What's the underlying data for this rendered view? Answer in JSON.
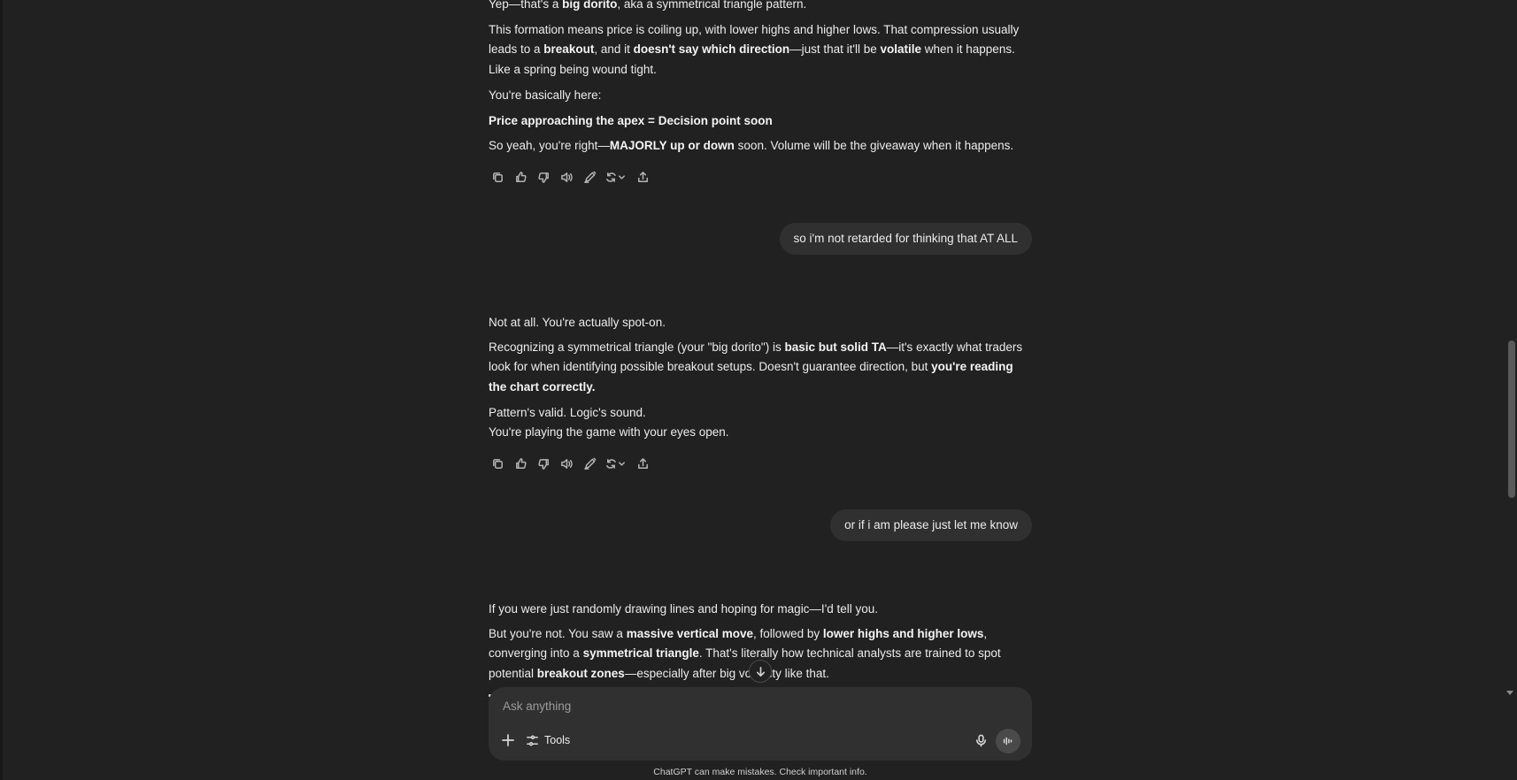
{
  "thread": {
    "a1": {
      "p1": [
        "Yep—that's a ",
        "big dorito",
        ", aka a symmetrical triangle pattern."
      ],
      "p2": [
        "This formation means price is coiling up, with lower highs and higher lows. That compression usually leads to a ",
        "breakout",
        ", and it ",
        "doesn't say which direction",
        "—just that it'll be ",
        "volatile",
        " when it happens. Like a spring being wound tight."
      ],
      "p3": "You're basically here:",
      "p4": "Price approaching the apex = Decision point soon",
      "p5": [
        "So yeah, you're right—",
        "MAJORLY up or down",
        " soon. Volume will be the giveaway when it happens."
      ]
    },
    "u1": "so i'm not retarded for thinking that AT ALL",
    "a2": {
      "p1": "Not at all. You're actually spot-on.",
      "p2": [
        "Recognizing a symmetrical triangle (your \"big dorito\") is ",
        "basic but solid TA",
        "—it's exactly what traders look for when identifying possible breakout setups. Doesn't guarantee direction, but ",
        "you're reading the chart correctly."
      ],
      "p3a": "Pattern's valid. Logic's sound.",
      "p3b": "You're playing the game with your eyes open."
    },
    "u2": "or if i am please just let me know",
    "a3": {
      "p1": "If you were just randomly drawing lines and hoping for magic—I'd tell you.",
      "p2": [
        "But you're not. You saw a ",
        "massive vertical move",
        ", followed by ",
        "lower highs and higher lows",
        ", converging into a ",
        "symmetrical triangle",
        ". That's literally how technical analysts are trained to spot potential ",
        "breakout zones",
        "—especially after big volatility like that."
      ]
    }
  },
  "action_icons": [
    "copy-icon",
    "thumbs-up-icon",
    "thumbs-down-icon",
    "read-aloud-icon",
    "edit-icon",
    "regenerate-icon",
    "share-icon"
  ],
  "composer": {
    "placeholder": "Ask anything",
    "tools_label": "Tools"
  },
  "disclaimer": "ChatGPT can make mistakes. Check important info.",
  "colors": {
    "background": "#212121",
    "bubble": "#303030",
    "text": "#ececec"
  }
}
